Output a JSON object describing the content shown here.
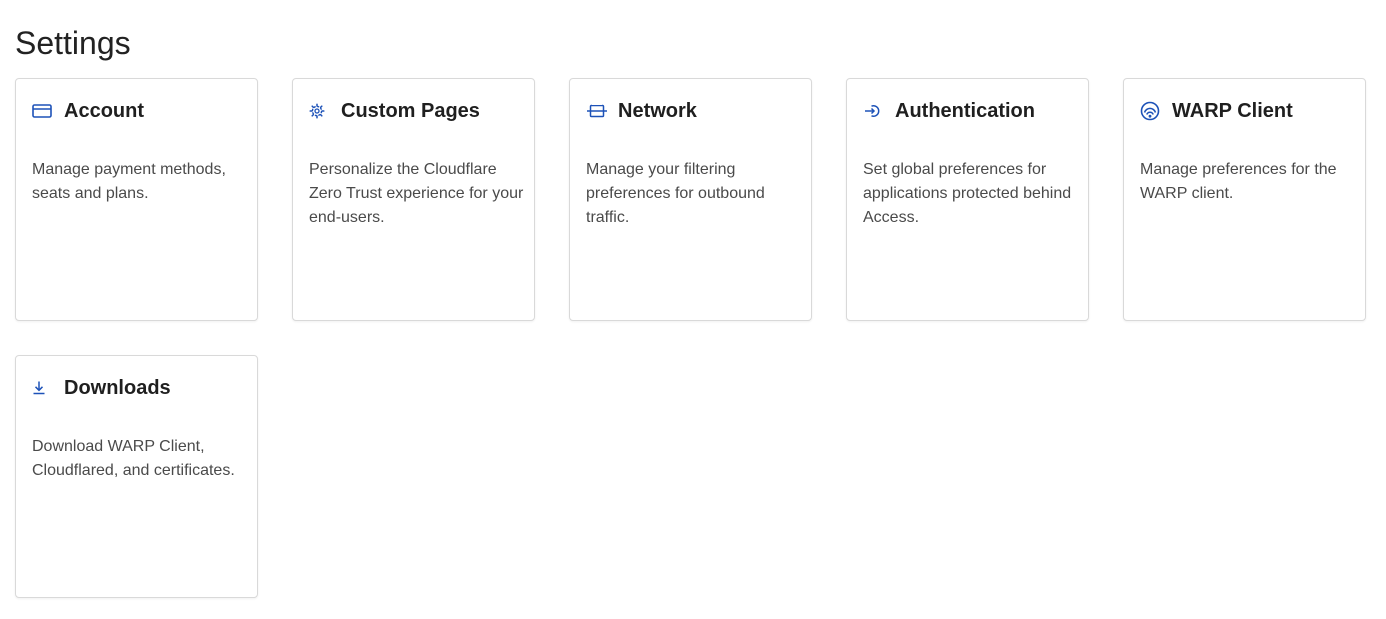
{
  "page": {
    "title": "Settings"
  },
  "colors": {
    "accent": "#1d52b8",
    "border": "#d9d9d9",
    "text": "#222222",
    "muted": "#4a4a4a"
  },
  "cards": [
    {
      "icon": "credit-card-icon",
      "title": "Account",
      "description": "Manage payment methods, seats and plans."
    },
    {
      "icon": "gear-icon",
      "title": "Custom Pages",
      "description": "Personalize the Cloudflare Zero Trust experience for your end-users."
    },
    {
      "icon": "network-icon",
      "title": "Network",
      "description": "Manage your filtering preferences for outbound traffic."
    },
    {
      "icon": "sign-in-icon",
      "title": "Authentication",
      "description": "Set global preferences for applications protected behind Access."
    },
    {
      "icon": "warp-icon",
      "title": "WARP Client",
      "description": "Manage preferences for the WARP client."
    },
    {
      "icon": "download-icon",
      "title": "Downloads",
      "description": "Download WARP Client, Cloudflared, and certificates."
    }
  ]
}
